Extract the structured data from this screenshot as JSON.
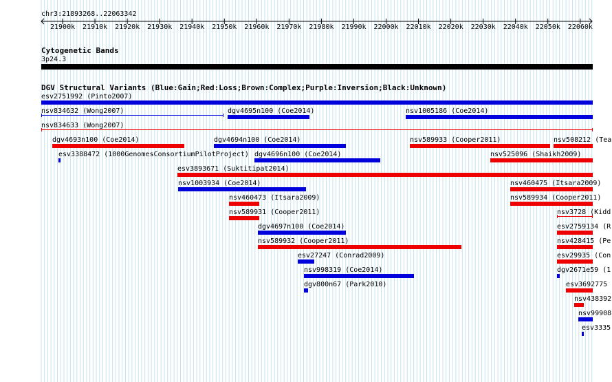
{
  "position": "chr3:21893268..22063342",
  "ruler": {
    "ticks": [
      "21900k",
      "21910k",
      "21920k",
      "21930k",
      "21940k",
      "21950k",
      "21960k",
      "21970k",
      "21980k",
      "21990k",
      "22000k",
      "22010k",
      "22020k",
      "22030k",
      "22040k",
      "22050k",
      "22060k"
    ]
  },
  "cytoband": {
    "title": "Cytogenetic Bands",
    "band": "3p24.3"
  },
  "dgv": {
    "title": "DGV Structural Variants (Blue:Gain;Red:Loss;Brown:Complex;Purple:Inversion;Black:Unknown)",
    "colors": {
      "gain": "#0000dd",
      "loss": "#ee0000"
    },
    "variants": [
      "esv2751992 (Pinto2007)",
      "nsv834632 (Wong2007)",
      "dgv4695n100 (Coe2014)",
      "nsv1005186 (Coe2014)",
      "nsv834633 (Wong2007)",
      "dgv4693n100 (Coe2014)",
      "dgv4694n100 (Coe2014)",
      "nsv589933 (Cooper2011)",
      "nsv508212 (Tea",
      "esv3388472 (1000GenomesConsortiumPilotProject)",
      "dgv4696n100 (Coe2014)",
      "nsv525096 (Shaikh2009)",
      "esv3893671 (Suktitipat2014)",
      "nsv1003934 (Coe2014)",
      "nsv460475 (Itsara2009)",
      "nsv460473 (Itsara2009)",
      "nsv589934 (Cooper2011)",
      "nsv589931 (Cooper2011)",
      "nsv3728 (Kidd",
      "dgv4697n100 (Coe2014)",
      "esv2759134 (R",
      "nsv589932 (Cooper2011)",
      "nsv428415 (Per",
      "esv27247 (Conrad2009)",
      "esv29935 (Con",
      "nsv998319 (Coe2014)",
      "dgv2671e59 (1",
      "dgv800n67 (Park2010)",
      "esv3692775",
      "nsv438392",
      "nsv99908",
      "esv3335"
    ]
  }
}
